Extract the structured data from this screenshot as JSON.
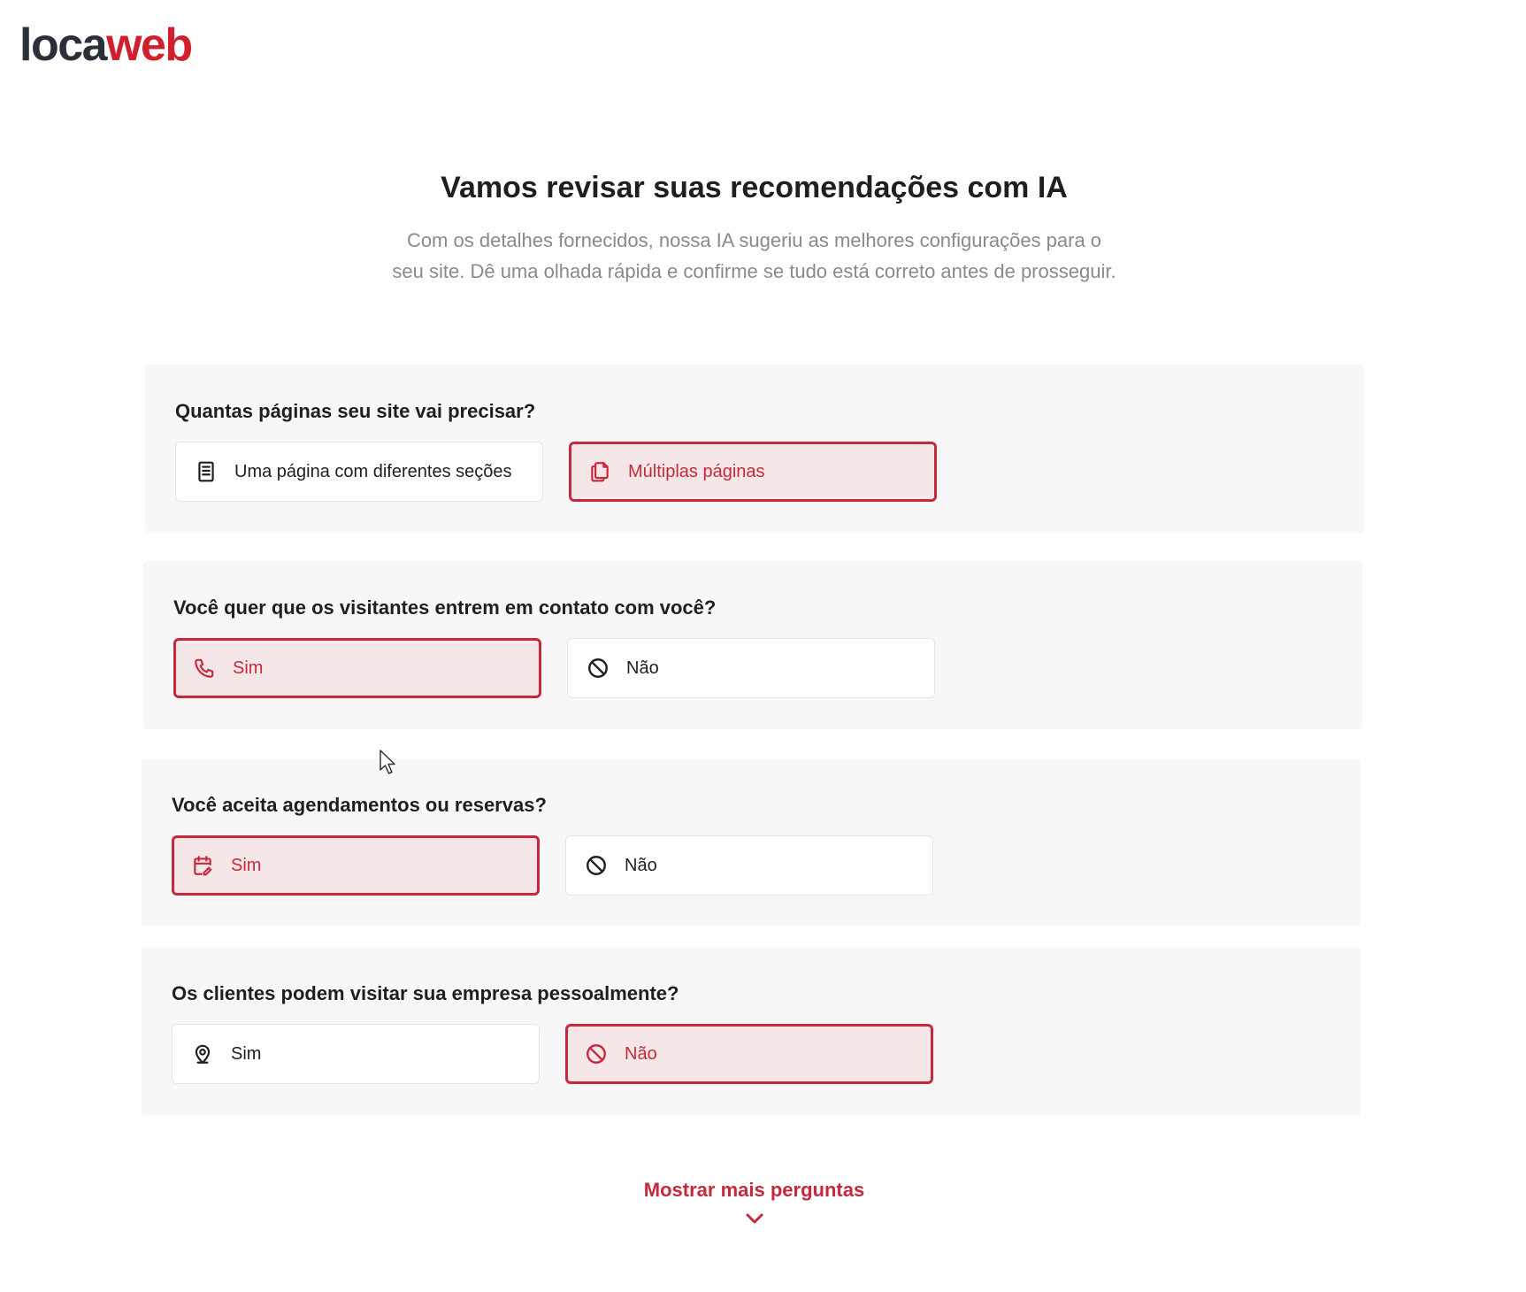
{
  "brand": {
    "part1": "loca",
    "part2": "web"
  },
  "hero": {
    "title": "Vamos revisar suas recomendações com IA",
    "subtitle": "Com os detalhes fornecidos, nossa IA sugeriu as melhores configurações para o seu site. Dê uma olhada rápida e confirme se tudo está correto antes de prosseguir."
  },
  "questions": [
    {
      "question": "Quantas páginas seu site vai precisar?",
      "options": [
        {
          "label": "Uma página com diferentes seções",
          "icon": "document-icon",
          "selected": false
        },
        {
          "label": "Múltiplas páginas",
          "icon": "copy-pages-icon",
          "selected": true
        }
      ]
    },
    {
      "question": "Você quer que os visitantes entrem em contato com você?",
      "options": [
        {
          "label": "Sim",
          "icon": "phone-icon",
          "selected": true
        },
        {
          "label": "Não",
          "icon": "prohibited-icon",
          "selected": false
        }
      ]
    },
    {
      "question": "Você aceita agendamentos ou reservas?",
      "options": [
        {
          "label": "Sim",
          "icon": "calendar-edit-icon",
          "selected": true
        },
        {
          "label": "Não",
          "icon": "prohibited-icon",
          "selected": false
        }
      ]
    },
    {
      "question": "Os clientes podem visitar sua empresa pessoalmente?",
      "options": [
        {
          "label": "Sim",
          "icon": "location-pin-icon",
          "selected": false
        },
        {
          "label": "Não",
          "icon": "prohibited-icon",
          "selected": true
        }
      ]
    }
  ],
  "show_more": {
    "label": "Mostrar mais perguntas",
    "icon": "chevron-down-icon"
  },
  "colors": {
    "accent": "#c6293c",
    "selected_bg": "#f5e6e8",
    "card_bg": "#f7f7f7",
    "logo_dark": "#2a2f3a",
    "logo_red": "#d0202e"
  }
}
